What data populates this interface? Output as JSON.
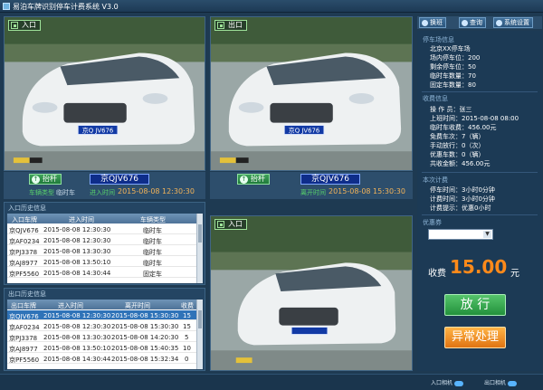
{
  "window": {
    "title": "易泊车牌识别停车计费系统 V3.0"
  },
  "entry_camera": {
    "label": "入口",
    "plate_on_car": "京Q JV676",
    "gate_button": "抬杆",
    "plate": "京QJV676",
    "time": "2015-08-08 12:30:30",
    "car_type_label": "车辆类型",
    "car_type": "临时车",
    "time_label": "进入时间"
  },
  "exit_camera": {
    "label": "出口",
    "plate_on_car": "京Q JV676",
    "gate_button": "抬杆",
    "plate": "京QJV676",
    "time_label": "离开时间",
    "time": "2015-08-08 15:30:30"
  },
  "center_camera": {
    "label": "入口"
  },
  "entry_history": {
    "title": "入口历史信息",
    "columns": [
      "入口车牌",
      "进入时间",
      "车辆类型"
    ],
    "rows": [
      [
        "京QJV676",
        "2015-08-08 12:30:30",
        "临时车"
      ],
      [
        "京AF0234",
        "2015-08-08 12:30:30",
        "临时车"
      ],
      [
        "京PJ3378",
        "2015-08-08 13:30:30",
        "临时车"
      ],
      [
        "京AJ8977",
        "2015-08-08 13:50:10",
        "临时车"
      ],
      [
        "京PF5560",
        "2015-08-08 14:30:44",
        "固定车"
      ]
    ]
  },
  "exit_history": {
    "title": "出口历史信息",
    "columns": [
      "出口车牌",
      "进入时间",
      "离开时间",
      "收费"
    ],
    "rows": [
      [
        "京QJV676",
        "2015-08-08 12:30:30",
        "2015-08-08 15:30:30",
        "15"
      ],
      [
        "京AF0234",
        "2015-08-08 12:30:30",
        "2015-08-08 15:30:30",
        "15"
      ],
      [
        "京PJ3378",
        "2015-08-08 13:30:30",
        "2015-08-08 14:20:30",
        "5"
      ],
      [
        "京AJ8977",
        "2015-08-08 13:50:10",
        "2015-08-08 15:40:35",
        "10"
      ],
      [
        "京PF5560",
        "2015-08-08 14:30:44",
        "2015-08-08 15:32:34",
        "0"
      ]
    ]
  },
  "toolbar": {
    "switch_label": "换班",
    "query_label": "查询",
    "settings_label": "系统设置"
  },
  "parking_info": {
    "title": "停车场信息",
    "name": "北京XX停车场",
    "rows": [
      {
        "label": "场内停车位",
        "value": "200"
      },
      {
        "label": "剩余停车位",
        "value": "50"
      },
      {
        "label": "临时车数量",
        "value": "70"
      },
      {
        "label": "固定车数量",
        "value": "80"
      }
    ]
  },
  "fee_info": {
    "title": "收费信息",
    "rows": [
      {
        "label": "操 作 员",
        "value": "张三"
      },
      {
        "label": "上班时间",
        "value": "2015-08-08 08:00"
      },
      {
        "label": "临时车收费",
        "value": "456.00元"
      },
      {
        "label": "免费车次",
        "value": "7（辆）"
      },
      {
        "label": "手动放行",
        "value": "0（次）"
      },
      {
        "label": "优惠车数",
        "value": "0（辆）"
      },
      {
        "label": "共收金额",
        "value": "456.00元"
      }
    ]
  },
  "current_fee": {
    "title": "本次计费",
    "rows": [
      {
        "label": "停车时间",
        "value": "3小时0分钟"
      },
      {
        "label": "计费时间",
        "value": "3小时0分钟"
      },
      {
        "label": "计费提示",
        "value": "优惠0小时"
      }
    ]
  },
  "discount": {
    "title": "优惠券",
    "selected": ""
  },
  "fee": {
    "label": "收费",
    "amount": "15.00",
    "unit": "元"
  },
  "actions": {
    "release_label": "放 行",
    "exception_label": "异常处理"
  },
  "status": {
    "entry_camera": "入口相机",
    "exit_camera": "出口相机"
  },
  "colors": {
    "accent_orange": "#ff8a1a",
    "gate_green": "#2da548",
    "plate_blue": "#0e2d8a"
  }
}
